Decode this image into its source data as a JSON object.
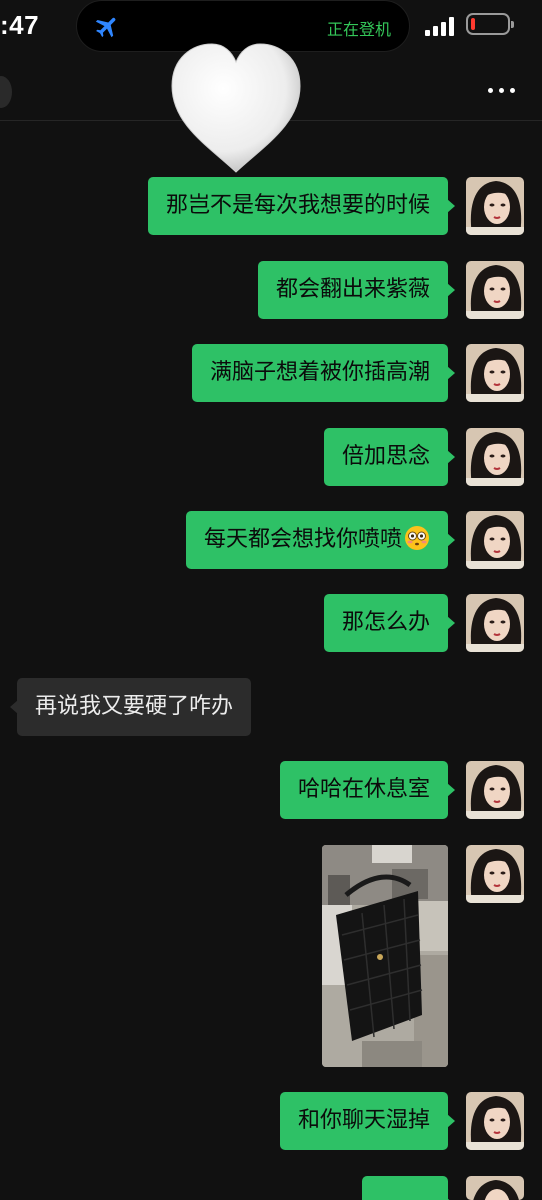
{
  "status_bar": {
    "time": ":47",
    "island_status": "正在登机",
    "airplane_icon": "airplane-icon",
    "signal_bars": 4,
    "battery_level": 0.12,
    "battery_color": "#ff3b30",
    "accent_green": "#34c759"
  },
  "nav": {
    "more_icon": "more-dots-icon",
    "sticker": "white-heart-sticker"
  },
  "colors": {
    "outgoing_bubble": "#2ec166",
    "incoming_bubble": "#2c2c2c",
    "background": "#111111"
  },
  "messages": [
    {
      "side": "out",
      "text": "那岂不是每次我想要的时候"
    },
    {
      "side": "out",
      "text": "都会翻出来紫薇"
    },
    {
      "side": "out",
      "text": "满脑子想着被你插高潮"
    },
    {
      "side": "out",
      "text": "倍加思念"
    },
    {
      "side": "out",
      "text": "每天都会想找你喷喷",
      "emoji": "flushed-face-emoji"
    },
    {
      "side": "out",
      "text": "那怎么办"
    },
    {
      "side": "in",
      "text": "再说我又要硬了咋办"
    },
    {
      "side": "out",
      "text": "哈哈在休息室"
    },
    {
      "side": "out",
      "type": "image",
      "image": "photo-black-quilted-bag-in-lounge"
    },
    {
      "side": "out",
      "text": "和你聊天湿掉"
    },
    {
      "side": "out",
      "text": ""
    }
  ]
}
